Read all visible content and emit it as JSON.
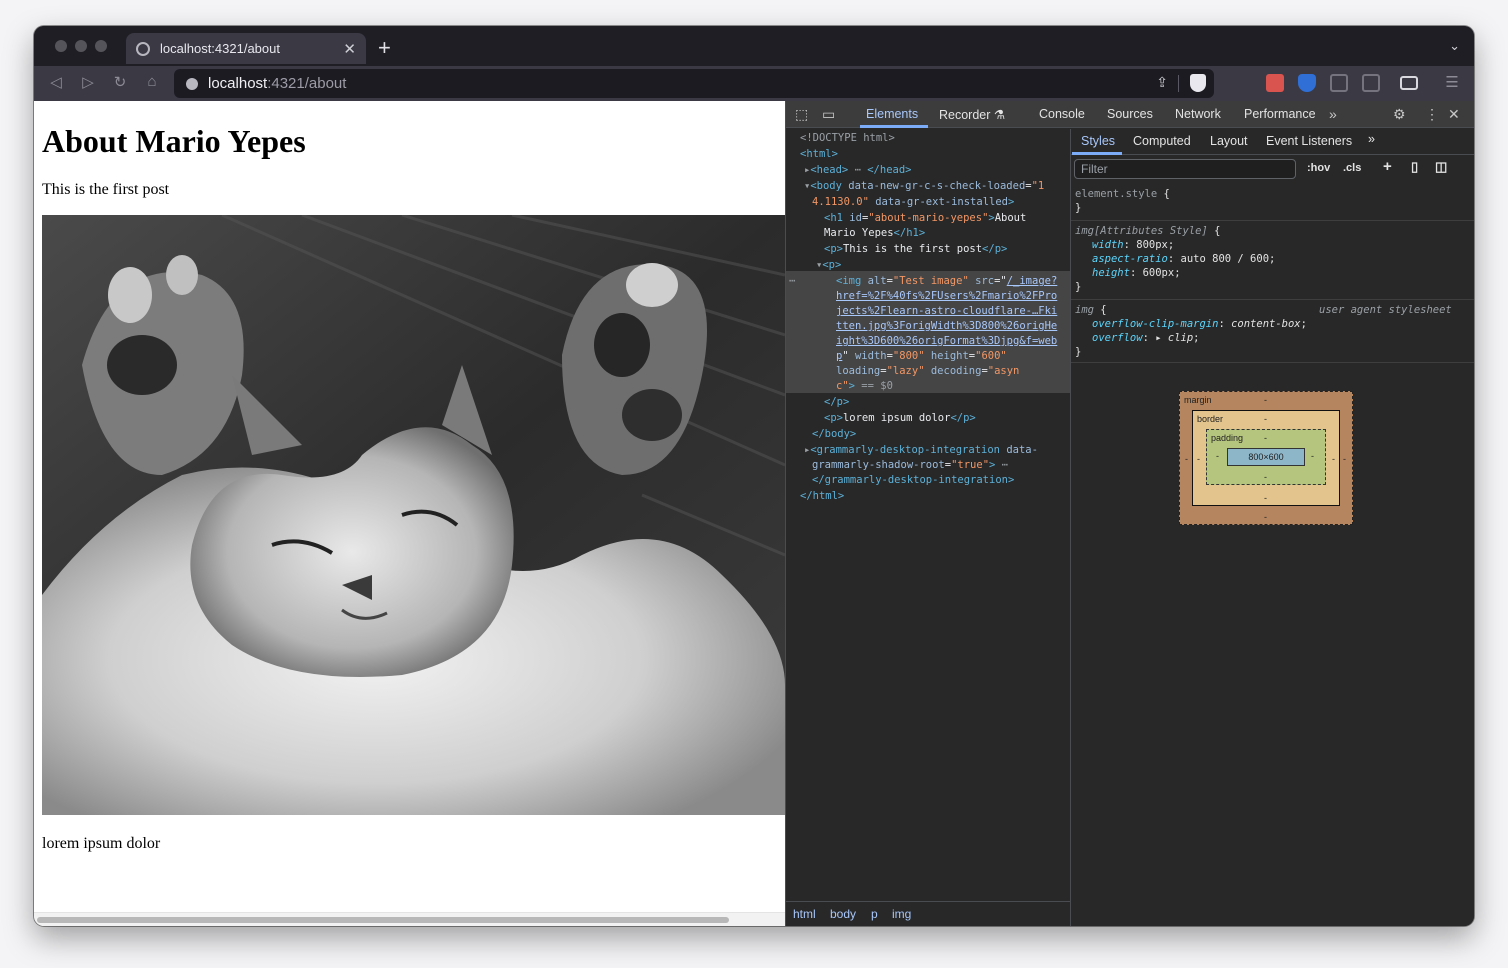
{
  "browser": {
    "tab_title": "localhost:4321/about",
    "tab_close": "✕",
    "new_tab": "+",
    "tab_menu": "⌄",
    "url_host": "localhost",
    "url_path": ":4321/about",
    "nav": {
      "back": "◁",
      "forward": "▷",
      "reload": "↻",
      "home": "⌂"
    },
    "share_glyph": "⇪",
    "menu_glyph": "☰"
  },
  "page": {
    "heading": "About Mario Yepes",
    "first_paragraph": "This is the first post",
    "image_alt": "Test image",
    "last_paragraph": "lorem ipsum dolor"
  },
  "devtools": {
    "tabs": [
      "Elements",
      "Recorder ⚗",
      "Console",
      "Sources",
      "Network",
      "Performance"
    ],
    "more": "»",
    "settings_glyph": "⚙",
    "kebab_glyph": "⋮",
    "close_glyph": "✕",
    "inspect_glyph": "⬚",
    "device_glyph": "▭",
    "dom": {
      "doctype": "<!DOCTYPE html>",
      "html_open": "<html>",
      "head": "<head>",
      "head_close": "</head>",
      "body_open": "<body",
      "body_attr1": "data-new-gr-c-s-check-loaded",
      "body_val1_a": "\"1",
      "body_val1_b": "4.1130.0\"",
      "body_attr2": "data-gr-ext-installed",
      "h1_open": "<h1 ",
      "h1_attr": "id",
      "h1_val": "\"about-mario-yepes\"",
      "h1_text_a": "About",
      "h1_text_b": "Mario Yepes",
      "h1_close": "</h1>",
      "p1_open": "<p>",
      "p1_text": "This is the first post",
      "p1_close": "</p>",
      "p_open": "<p>",
      "img_open": "<img ",
      "img_alt_attr": "alt",
      "img_alt_val": "\"Test image\"",
      "img_src_attr": "src",
      "img_src_1": "/_image?",
      "img_src_2": "href=%2F%40fs%2FUsers%2Fmario%2FPro",
      "img_src_3": "jects%2Flearn-astro-cloudflare-…Fki",
      "img_src_4": "tten.jpg%3ForigWidth%3D800%26origHe",
      "img_src_5": "ight%3D600%26origFormat%3Djpg&f=web",
      "img_src_6": "p",
      "img_w_attr": "width",
      "img_w_val": "\"800\"",
      "img_h_attr": "height",
      "img_h_val": "\"600\"",
      "img_loading_attr": "loading",
      "img_loading_val": "\"lazy\"",
      "img_decoding_attr": "decoding",
      "img_decoding_val_a": "\"asyn",
      "img_decoding_val_b": "c\"",
      "img_end": ">",
      "img_marker": " == $0",
      "p_close": "</p>",
      "p2_open": "<p>",
      "p2_text": "lorem ipsum dolor",
      "p2_close": "</p>",
      "body_close": "</body>",
      "gram_open": "<grammarly-desktop-integration",
      "gram_attr_a": "data-",
      "gram_attr_b": "grammarly-shadow-root",
      "gram_val": "\"true\"",
      "gram_close": "</grammarly-desktop-integration>",
      "html_close": "</html>"
    },
    "breadcrumbs": [
      "html",
      "body",
      "p",
      "img"
    ],
    "styles_tabs": [
      "Styles",
      "Computed",
      "Layout",
      "Event Listeners"
    ],
    "filter_placeholder": "Filter",
    "hov": ":hov",
    "cls": ".cls",
    "rules": {
      "element_style": "element.style",
      "attr_selector": "img[Attributes Style]",
      "width_prop": "width",
      "width_val": "800px",
      "ar_prop": "aspect-ratio",
      "ar_val": "auto 800 / 600",
      "height_prop": "height",
      "height_val": "600px",
      "ua_selector": "img",
      "ua_label": "user agent stylesheet",
      "ocm_prop": "overflow-clip-margin",
      "ocm_val": "content-box",
      "of_prop": "overflow",
      "of_val": "clip"
    },
    "box_model": {
      "margin": "margin",
      "border": "border",
      "padding": "padding",
      "content": "800×600",
      "dash": "-"
    }
  }
}
